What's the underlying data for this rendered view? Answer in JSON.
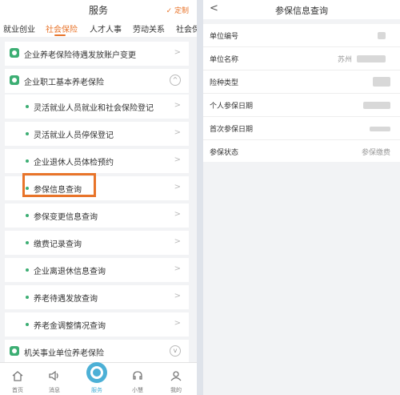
{
  "left": {
    "header": {
      "title": "服务",
      "custom_label": "✓ 定制"
    },
    "tabs": [
      {
        "label": "就业创业"
      },
      {
        "label": "社会保险"
      },
      {
        "label": "人才人事"
      },
      {
        "label": "劳动关系"
      },
      {
        "label": "社会保"
      }
    ],
    "rows": [
      {
        "label": "企业养老保险待遇发放账户变更"
      },
      {
        "label": "企业职工基本养老保险"
      },
      {
        "label": "灵活就业人员就业和社会保险登记"
      },
      {
        "label": "灵活就业人员停保登记"
      },
      {
        "label": "企业退休人员体检预约"
      },
      {
        "label": "参保信息查询"
      },
      {
        "label": "参保变更信息查询"
      },
      {
        "label": "缴费记录查询"
      },
      {
        "label": "企业离退休信息查询"
      },
      {
        "label": "养老待遇发放查询"
      },
      {
        "label": "养老金调整情况查询"
      },
      {
        "label": "机关事业单位养老保险"
      }
    ],
    "bottom_nav": [
      {
        "label": "首页",
        "icon": "home-icon"
      },
      {
        "label": "消息",
        "icon": "speaker-icon"
      },
      {
        "label": "服务",
        "icon": "service-icon"
      },
      {
        "label": "小慧",
        "icon": "headset-icon"
      },
      {
        "label": "我的",
        "icon": "person-icon"
      }
    ],
    "colors": {
      "accent": "#e8742a",
      "green": "#3cae73",
      "service_blue": "#4cb0d6"
    }
  },
  "right": {
    "header": {
      "title": "参保信息查询"
    },
    "rows": [
      {
        "label": "单位编号",
        "value": ""
      },
      {
        "label": "单位名称",
        "value": "苏州"
      },
      {
        "label": "险种类型",
        "value": ""
      },
      {
        "label": "个人参保日期",
        "value": ""
      },
      {
        "label": "首次参保日期",
        "value": ""
      },
      {
        "label": "参保状态",
        "value": "参保缴费"
      }
    ]
  }
}
